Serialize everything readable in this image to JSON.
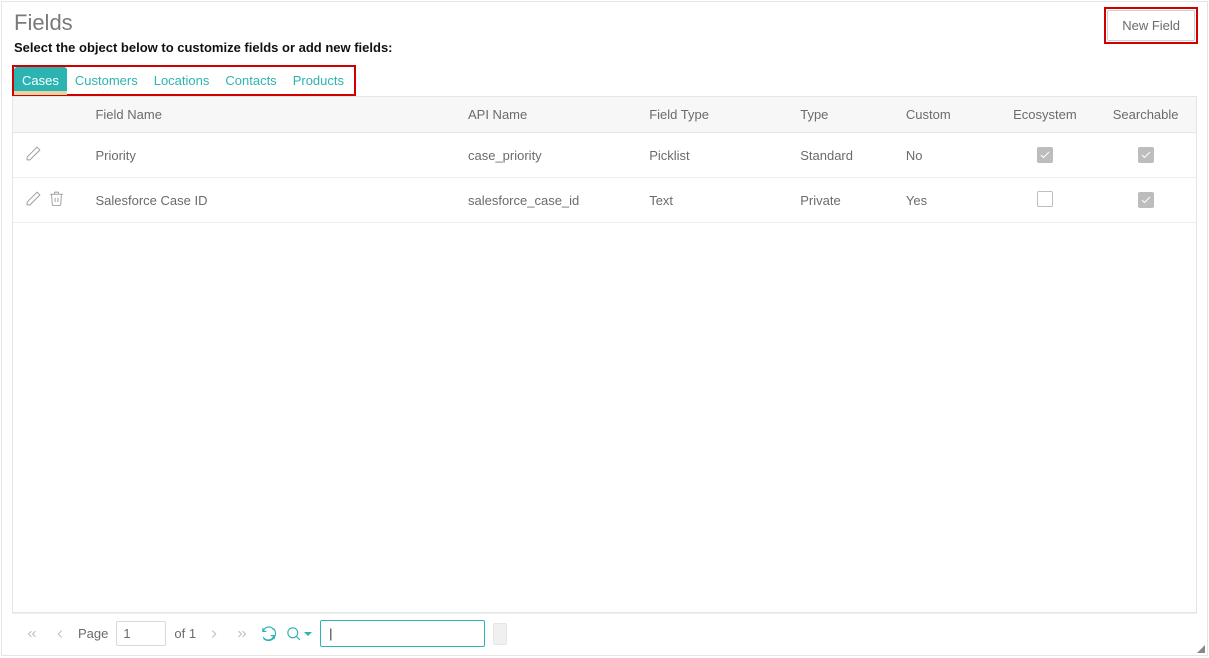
{
  "header": {
    "title": "Fields",
    "subtitle": "Select the object below to customize fields or add new fields:",
    "new_field_label": "New Field"
  },
  "tabs": [
    {
      "label": "Cases",
      "active": true
    },
    {
      "label": "Customers",
      "active": false
    },
    {
      "label": "Locations",
      "active": false
    },
    {
      "label": "Contacts",
      "active": false
    },
    {
      "label": "Products",
      "active": false
    }
  ],
  "columns": {
    "field_name": "Field Name",
    "api_name": "API Name",
    "field_type": "Field Type",
    "type": "Type",
    "custom": "Custom",
    "ecosystem": "Ecosystem",
    "searchable": "Searchable"
  },
  "rows": [
    {
      "field_name": "Priority",
      "api_name": "case_priority",
      "field_type": "Picklist",
      "type": "Standard",
      "custom": "No",
      "ecosystem": true,
      "searchable": true,
      "deletable": false
    },
    {
      "field_name": "Salesforce Case ID",
      "api_name": "salesforce_case_id",
      "field_type": "Text",
      "type": "Private",
      "custom": "Yes",
      "ecosystem": false,
      "searchable": true,
      "deletable": true
    }
  ],
  "pager": {
    "page_label": "Page",
    "page_value": "1",
    "of_label": "of 1"
  }
}
